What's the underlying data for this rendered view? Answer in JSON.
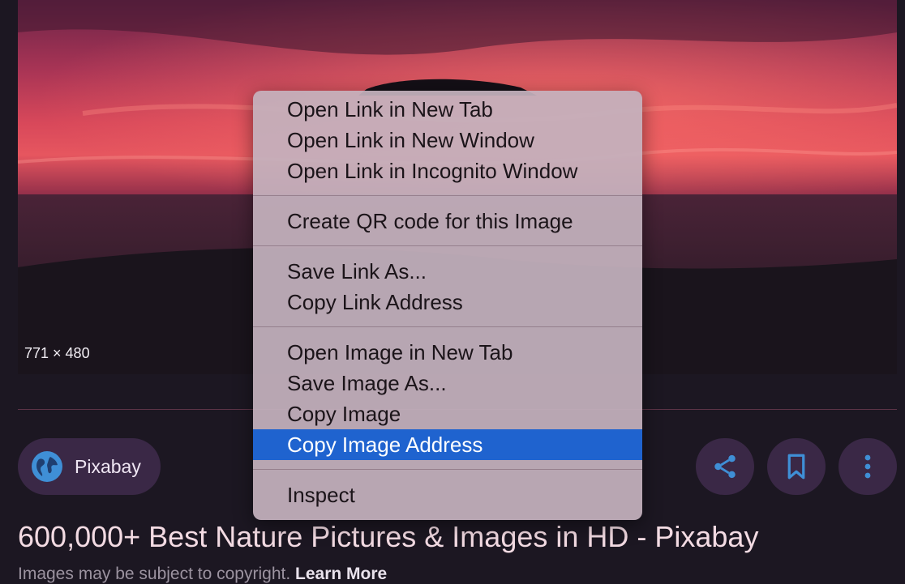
{
  "image": {
    "dimensions": "771 × 480"
  },
  "source": {
    "name": "Pixabay",
    "icon": "globe-icon"
  },
  "actions": {
    "share_icon": "share-icon",
    "save_icon": "bookmark-icon",
    "more_icon": "more-vert-icon"
  },
  "result": {
    "title": "600,000+ Best Nature Pictures & Images in HD - Pixabay",
    "copyright_text": "Images may be subject to copyright.",
    "learn_more": "Learn More"
  },
  "context_menu": {
    "groups": [
      [
        "Open Link in New Tab",
        "Open Link in New Window",
        "Open Link in Incognito Window"
      ],
      [
        "Create QR code for this Image"
      ],
      [
        "Save Link As...",
        "Copy Link Address"
      ],
      [
        "Open Image in New Tab",
        "Save Image As...",
        "Copy Image",
        "Copy Image Address"
      ],
      [
        "Inspect"
      ]
    ],
    "highlighted": "Copy Image Address"
  },
  "colors": {
    "highlight": "#1f63cf",
    "chip_background": "#3a2846",
    "icon_blue": "#3f8fd6"
  }
}
